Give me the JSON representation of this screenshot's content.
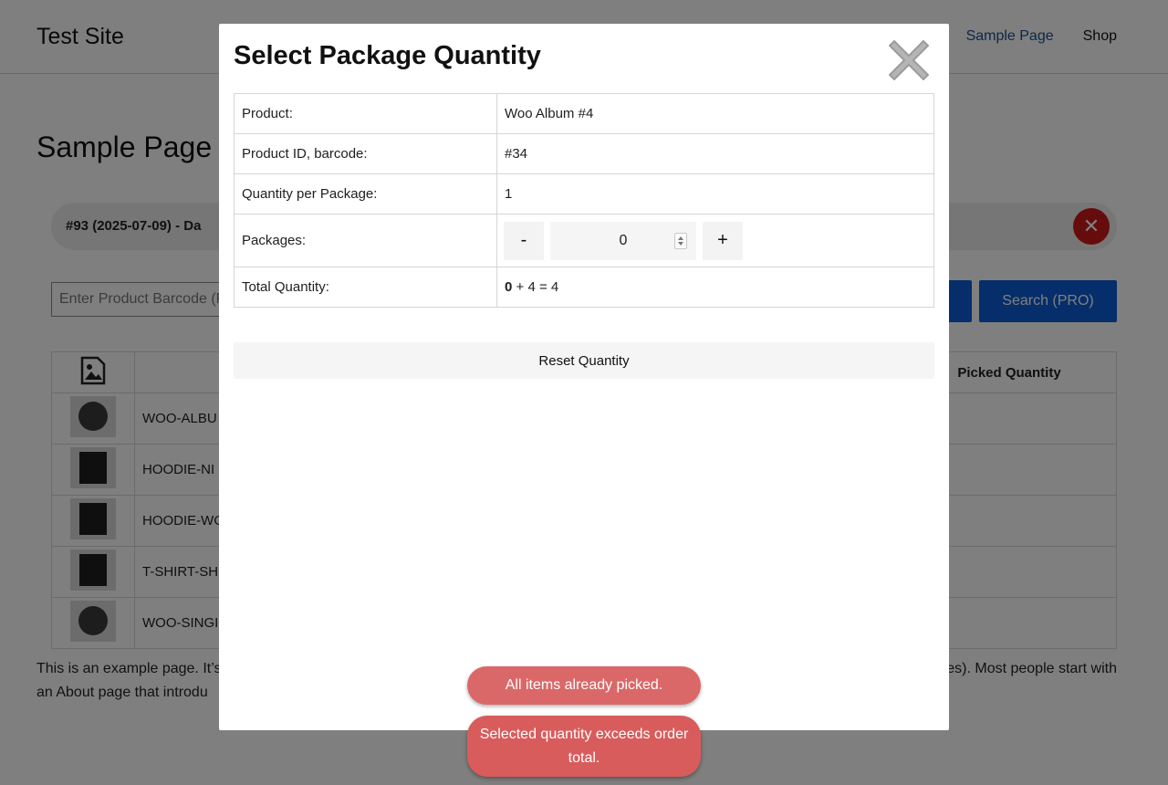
{
  "site": {
    "title": "Test Site",
    "nav": [
      "Sample Page",
      "Shop"
    ]
  },
  "page": {
    "title": "Sample Page",
    "order_label": "#93 (2025-07-09) - Da",
    "barcode_placeholder": "Enter Product Barcode (P",
    "scan_label": "",
    "search_label": "Search (PRO)",
    "table": {
      "picked_header": "Picked Quantity",
      "rows": [
        {
          "sku": "WOO-ALBU"
        },
        {
          "sku": "HOODIE-NI"
        },
        {
          "sku": "HOODIE-WO"
        },
        {
          "sku": "T-SHIRT-SH"
        },
        {
          "sku": "WOO-SINGI"
        }
      ]
    },
    "body_text_line1": "This is an example page. It’s",
    "body_text_line1_end": "es). Most people start with",
    "body_text_line2": "an About page that introdu"
  },
  "modal": {
    "title": "Select Package Quantity",
    "rows": {
      "product_label": "Product:",
      "product_value": "Woo Album #4",
      "id_label": "Product ID, barcode:",
      "id_value": "#34",
      "qpp_label": "Quantity per Package:",
      "qpp_value": "1",
      "packages_label": "Packages:",
      "packages_value": "0",
      "minus_label": "-",
      "plus_label": "+",
      "total_label": "Total Quantity:",
      "total_bold": "0",
      "total_rest": " + 4 = 4"
    },
    "reset_label": "Reset Quantity"
  },
  "toasts": {
    "first": "All items already picked.",
    "second": "Selected quantity exceeds order total."
  },
  "colors": {
    "accent_blue": "#0b5cd5",
    "danger_red": "#cc1818",
    "toast_red": "#d95c5c",
    "overlay": "rgba(0,0,0,0.5)"
  }
}
